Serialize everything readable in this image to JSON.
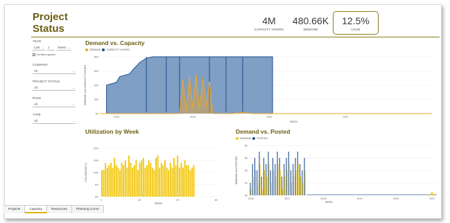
{
  "page": {
    "title": "Project Status"
  },
  "kpis": [
    {
      "value": "4M",
      "label": "CAPACITY HOURS"
    },
    {
      "value": "480.66K",
      "label": "DEMAND"
    },
    {
      "value": "12.5%",
      "label": "LOAD"
    }
  ],
  "filters": {
    "year_label": "YEAR",
    "year_from": "Last",
    "year_n": "1",
    "year_unit": "Select",
    "no_filters_text": "No filters applied",
    "company_label": "COMPANY",
    "company_value": "All",
    "project_status_label": "PROJECT STATUS",
    "project_status_value": "All",
    "role_label": "ROLE",
    "role_value": "All",
    "type_label": "TYPE",
    "type_value": "All"
  },
  "tabs": [
    "Projects",
    "Capacity",
    "Resources",
    "Planning Curve"
  ],
  "active_tab": "Capacity",
  "colors": {
    "brand": "#6b5d12",
    "demand": "#f0a52a",
    "capacity": "#1e4e8c",
    "capacity_fill": "#7f9fc4",
    "utilization": "#f2c811"
  },
  "chart_data": [
    {
      "type": "area",
      "title": "Demand vs. Capacity",
      "xlabel": "WEEK",
      "ylabel": "DEMAND and CAPACITY HOURS",
      "legend_placement": "top-left",
      "series": [
        {
          "name": "DEMAND"
        },
        {
          "name": "CAPACITY HOURS"
        }
      ],
      "x_ticks": [
        "2018",
        "2019",
        "2020",
        "2021"
      ],
      "y_ticks": [
        "0K",
        "20K",
        "40K",
        "60K",
        "80K"
      ],
      "ylim": [
        0,
        80
      ],
      "capacity_points": [
        [
          0,
          0
        ],
        [
          2,
          0
        ],
        [
          2,
          40
        ],
        [
          5,
          44
        ],
        [
          6,
          52
        ],
        [
          9,
          56
        ],
        [
          10,
          62
        ],
        [
          12,
          72
        ],
        [
          14,
          78
        ],
        [
          16,
          80
        ],
        [
          48,
          80
        ],
        [
          52,
          80
        ],
        [
          52,
          0
        ],
        [
          100,
          0
        ]
      ],
      "capacity_dips": [
        14,
        20,
        24,
        33,
        38,
        43
      ],
      "demand_points": [
        [
          0,
          0
        ],
        [
          24,
          0
        ],
        [
          25,
          48
        ],
        [
          26,
          5
        ],
        [
          27,
          52
        ],
        [
          28,
          8
        ],
        [
          29,
          55
        ],
        [
          30,
          6
        ],
        [
          31,
          50
        ],
        [
          32,
          10
        ],
        [
          33,
          45
        ],
        [
          34,
          0
        ],
        [
          40,
          0
        ],
        [
          43,
          2
        ],
        [
          46,
          0
        ],
        [
          52,
          0
        ],
        [
          100,
          0
        ]
      ]
    },
    {
      "type": "bar",
      "title": "Utilization by Week",
      "xlabel": "WEEK",
      "ylabel": "UTILIZATION %",
      "y_ticks": [
        "0%",
        "5%",
        "10%",
        "15%",
        "20%"
      ],
      "x_ticks": [
        "0",
        "20",
        "40",
        "60"
      ],
      "ylim": [
        0,
        20
      ],
      "values": [
        11,
        11,
        14,
        12,
        13,
        14,
        12,
        16,
        13,
        12,
        11,
        14,
        13,
        15,
        12,
        17,
        14,
        12,
        13,
        15,
        11,
        14,
        15,
        16,
        12,
        13,
        15,
        14,
        12,
        11,
        16,
        17,
        12,
        14,
        13,
        15,
        12,
        11,
        14,
        12,
        16,
        13,
        17,
        12,
        14,
        12,
        15,
        13,
        13,
        11,
        12,
        13
      ]
    },
    {
      "type": "line",
      "title": "Demand vs. Posted",
      "xlabel": "WEEK",
      "ylabel": "DEMAND and POSTED",
      "legend_placement": "top-left",
      "series": [
        {
          "name": "DEMAND"
        },
        {
          "name": "POSTED"
        }
      ],
      "x_ticks": [
        "2016",
        "2017",
        "2018",
        "2019",
        "2020",
        "2021"
      ],
      "y_ticks": [
        "0K",
        "2K",
        "4K",
        "6K",
        "8K"
      ],
      "ylim": [
        0,
        8
      ],
      "posted_spikes": [
        2,
        5,
        6,
        4,
        7,
        3,
        6,
        5,
        7,
        4,
        6,
        5,
        7,
        6,
        3,
        5,
        6,
        7,
        4,
        5,
        6,
        7,
        5,
        4,
        6
      ],
      "demand_spikes": [
        1,
        3,
        4,
        2,
        5,
        1,
        4,
        3,
        5,
        2,
        4,
        3,
        5,
        4,
        1,
        3,
        4,
        5,
        2,
        3,
        4,
        5,
        3,
        2,
        4
      ]
    }
  ]
}
